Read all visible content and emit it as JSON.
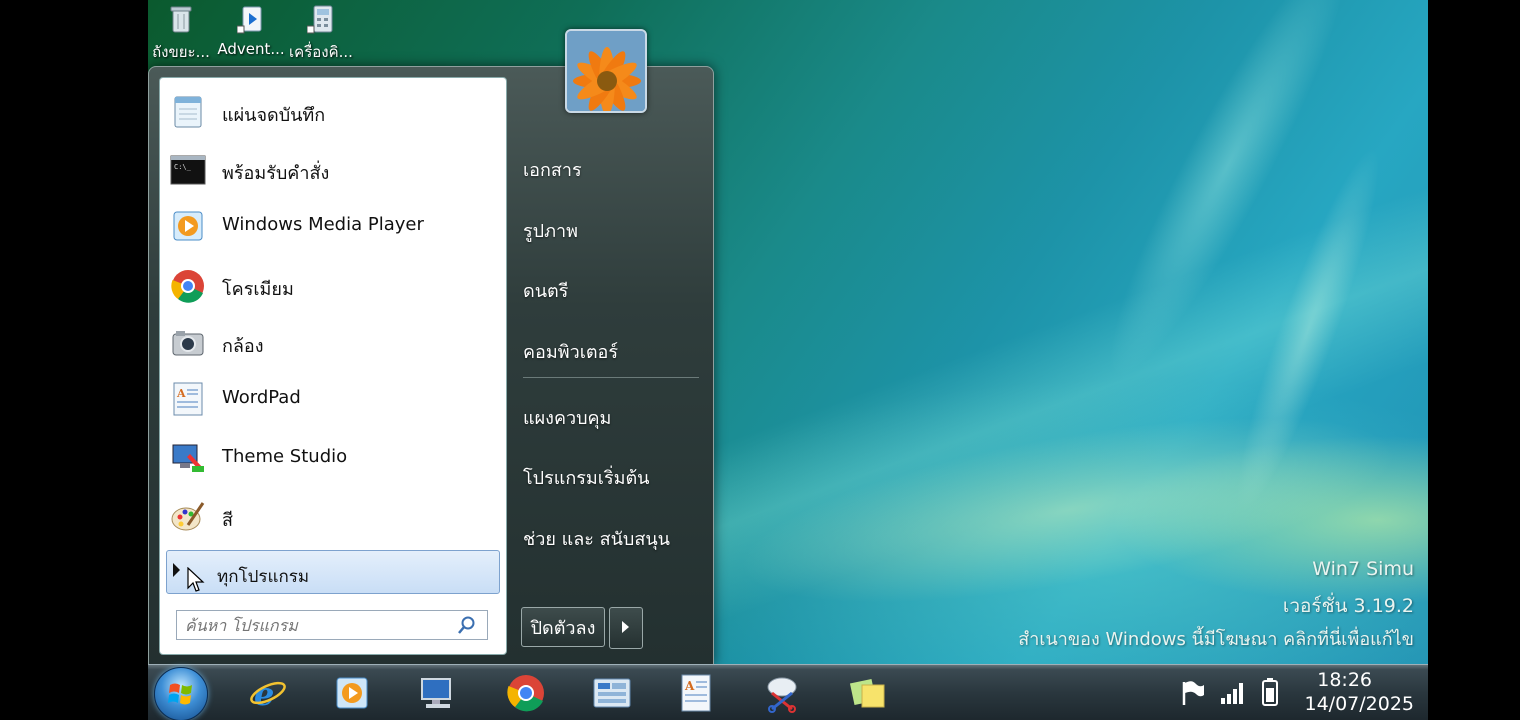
{
  "desktop": {
    "icons": [
      {
        "label": "ถังขยะ..."
      },
      {
        "label": "Advent..."
      },
      {
        "label": "เครื่องคิ..."
      }
    ],
    "watermark": {
      "line1": "Win7 Simu",
      "line2": "เวอร์ชั่น 3.19.2",
      "line3": "สำเนาของ Windows นี้มีโฆษณา คลิกที่นี่เพื่อแก้ไข"
    }
  },
  "start_menu": {
    "programs": [
      {
        "label": "แผ่นจดบันทึก",
        "icon": "notepad-icon"
      },
      {
        "label": "พร้อมรับคำสั่ง",
        "icon": "command-prompt-icon"
      },
      {
        "label": "Windows Media Player",
        "icon": "media-player-icon"
      },
      {
        "label": "โครเมียม",
        "icon": "chrome-icon"
      },
      {
        "label": "กล้อง",
        "icon": "camera-icon"
      },
      {
        "label": "WordPad",
        "icon": "wordpad-icon"
      },
      {
        "label": "Theme Studio",
        "icon": "theme-studio-icon"
      },
      {
        "label": "สี",
        "icon": "paint-icon"
      }
    ],
    "all_programs": "ทุกโปรแกรม",
    "search_placeholder": "ค้นหา โปรแกรม",
    "places": [
      {
        "label": "เอกสาร"
      },
      {
        "label": "รูปภาพ"
      },
      {
        "label": "ดนตรี"
      },
      {
        "label": "คอมพิวเตอร์"
      },
      {
        "label": "แผงควบคุม"
      },
      {
        "label": "โปรแกรมเริ่มต้น"
      },
      {
        "label": "ช่วย และ สนับสนุน"
      }
    ],
    "shutdown_label": "ปิดตัวลง"
  },
  "taskbar": {
    "pinned": [
      "internet-explorer-icon",
      "media-player-icon",
      "computer-icon",
      "chrome-icon",
      "control-panel-icon",
      "wordpad-icon",
      "snipping-tool-icon",
      "sticky-notes-icon"
    ],
    "clock": {
      "time": "18:26",
      "date": "14/07/2025"
    }
  },
  "colors": {
    "accent": "#3e8fd6",
    "menu_bg": "#2f3d3c"
  }
}
